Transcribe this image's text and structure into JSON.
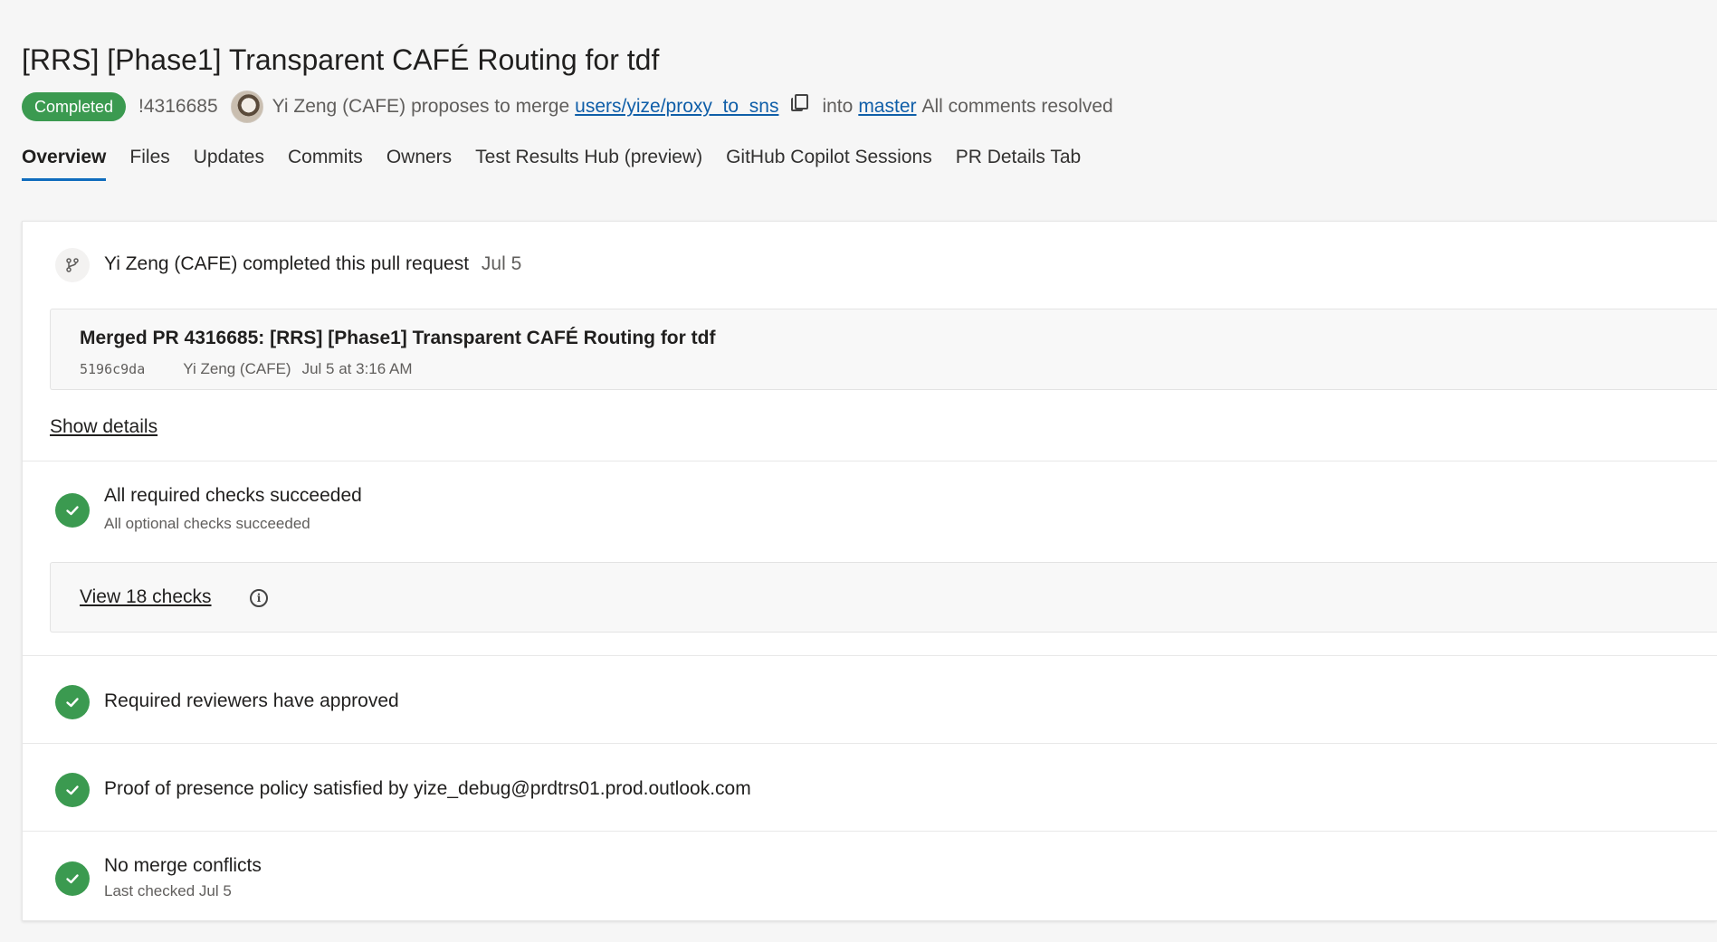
{
  "pr": {
    "title": "[RRS] [Phase1] Transparent CAFÉ Routing for tdf",
    "status": "Completed",
    "id": "!4316685",
    "author": "Yi Zeng (CAFE)",
    "proposes_text": "proposes to merge",
    "source_branch": "users/yize/proxy_to_sns",
    "into_text": "into",
    "target_branch": "master",
    "comments_status": "All comments resolved"
  },
  "tabs": [
    {
      "label": "Overview",
      "active": true
    },
    {
      "label": "Files"
    },
    {
      "label": "Updates"
    },
    {
      "label": "Commits"
    },
    {
      "label": "Owners"
    },
    {
      "label": "Test Results Hub (preview)"
    },
    {
      "label": "GitHub Copilot Sessions"
    },
    {
      "label": "PR Details Tab"
    }
  ],
  "completion": {
    "text": "Yi Zeng (CAFE) completed this pull request",
    "date": "Jul 5"
  },
  "merge_commit": {
    "title": "Merged PR 4316685: [RRS] [Phase1] Transparent CAFÉ Routing for tdf",
    "hash": "5196c9da",
    "author": "Yi Zeng (CAFE)",
    "time": "Jul 5 at 3:16 AM"
  },
  "show_details": "Show details",
  "checks": {
    "title": "All required checks succeeded",
    "subtitle": "All optional checks succeeded",
    "view_link": "View 18 checks"
  },
  "reviewers": {
    "title": "Required reviewers have approved"
  },
  "presence": {
    "title": "Proof of presence policy satisfied by yize_debug@prdtrs01.prod.outlook.com"
  },
  "conflicts": {
    "title": "No merge conflicts",
    "subtitle": "Last checked Jul 5"
  },
  "colors": {
    "success": "#3b9a50",
    "link": "#0f5ea8",
    "tab_underline": "#0f6cbd"
  }
}
